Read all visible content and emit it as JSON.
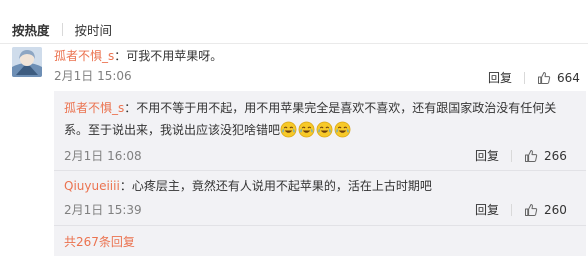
{
  "sort": {
    "by_heat": "按热度",
    "by_time": "按时间"
  },
  "main_comment": {
    "username": "孤者不惧_s",
    "text": "：可我不用苹果呀。",
    "time": "2月1日 15:06",
    "reply_label": "回复",
    "likes": "664"
  },
  "replies": [
    {
      "username": "孤者不惧_s",
      "text_line1": "：不用不等于用不起，用不用苹果完全是喜欢不喜欢，还有跟国家政治没有任何关",
      "text_line2": "系。至于说出来，我说出应该没犯啥错吧",
      "emoji": "laughing-crying-emoji",
      "time": "2月1日 16:08",
      "reply_label": "回复",
      "likes": "266"
    },
    {
      "username": "Qiuyueiiii",
      "text": "：心疼层主，竟然还有人说用不起苹果的，活在上古时期吧",
      "time": "2月1日 15:39",
      "reply_label": "回复",
      "likes": "260"
    }
  ],
  "total_replies": "共267条回复",
  "colors": {
    "username": "#eb7350",
    "reply_bg": "#f2f2f5",
    "meta": "#808080"
  }
}
